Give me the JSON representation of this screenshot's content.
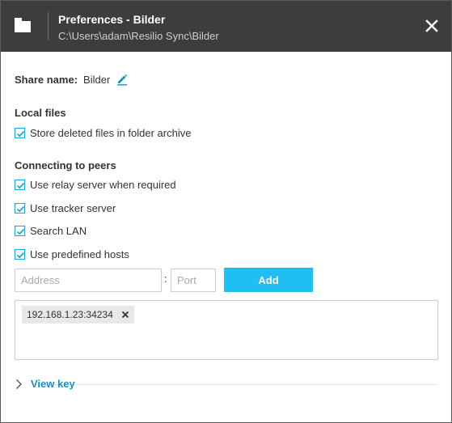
{
  "window": {
    "title": "Preferences - Bilder",
    "subtitle": "C:\\Users\\adam\\Resilio Sync\\Bilder"
  },
  "share": {
    "label": "Share name:",
    "value": "Bilder"
  },
  "local_files": {
    "heading": "Local files",
    "options": [
      {
        "label": "Store deleted files in folder archive",
        "checked": true
      }
    ]
  },
  "peers": {
    "heading": "Connecting to peers",
    "options": [
      {
        "label": "Use relay server when required",
        "checked": true
      },
      {
        "label": "Use tracker server",
        "checked": true
      },
      {
        "label": "Search LAN",
        "checked": true
      },
      {
        "label": "Use predefined hosts",
        "checked": true
      }
    ],
    "address_placeholder": "Address",
    "port_placeholder": "Port",
    "separator": ":",
    "add_label": "Add",
    "hosts": [
      "192.168.1.23:34234"
    ]
  },
  "view_key": {
    "label": "View key"
  },
  "colors": {
    "titlebar": "#3d3d3d",
    "accent": "#1ec0f3",
    "link": "#1a8fc7",
    "checkbox": "#1ea7d9"
  }
}
